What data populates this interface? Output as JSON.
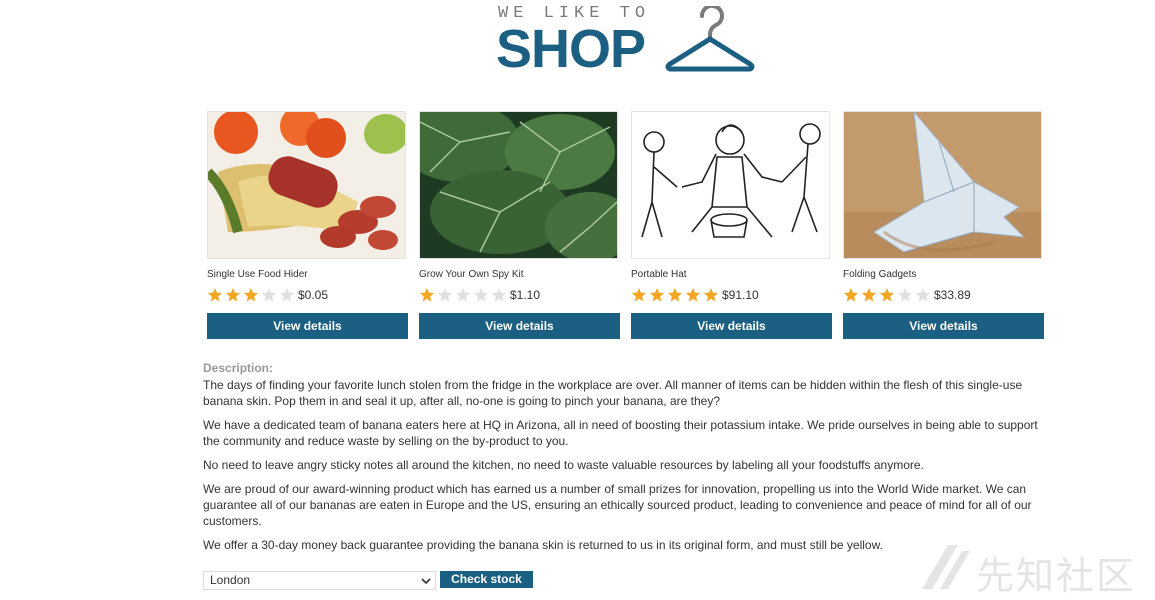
{
  "header": {
    "tagline": "WE LIKE TO",
    "brand": "SHOP",
    "brand_color": "#1b5f83"
  },
  "products": [
    {
      "name": "Single Use Food Hider",
      "price": "$0.05",
      "rating": 3,
      "button": "View details",
      "icon": "banana-salami-photo"
    },
    {
      "name": "Grow Your Own Spy Kit",
      "price": "$1.10",
      "rating": 1,
      "button": "View details",
      "icon": "leaves-photo"
    },
    {
      "name": "Portable Hat",
      "price": "$91.10",
      "rating": 5,
      "button": "View details",
      "icon": "cartoon-sketch"
    },
    {
      "name": "Folding Gadgets",
      "price": "$33.89",
      "rating": 3,
      "button": "View details",
      "icon": "origami-bird-photo"
    }
  ],
  "description": {
    "label": "Description:",
    "paragraphs": [
      "The days of finding your favorite lunch stolen from the fridge in the workplace are over. All manner of items can be hidden within the flesh of this single-use banana skin. Pop them in and seal it up, after all, no-one is going to pinch your banana, are they?",
      "We have a dedicated team of banana eaters here at HQ in Arizona, all in need of boosting their potassium intake. We pride ourselves in being able to support the community and reduce waste by selling on the by-product to you.",
      "No need to leave angry sticky notes all around the kitchen, no need to waste valuable resources by labeling all your foodstuffs anymore.",
      "We are proud of our award-winning product which has earned us a number of small prizes for innovation, propelling us into the World Wide market. We can guarantee all of our bananas are eaten in Europe and the US, ensuring an ethically sourced product, leading to convenience and peace of mind for all of our customers.",
      "We offer a 30-day money back guarantee providing the banana skin is returned to us in its original form, and must still be yellow."
    ]
  },
  "stock": {
    "selected_store": "London",
    "button": "Check stock"
  },
  "watermark": {
    "text": "先知社区"
  },
  "colors": {
    "accent": "#1b5f83",
    "star": "#f5a623",
    "star_empty": "#e0e0e0"
  }
}
